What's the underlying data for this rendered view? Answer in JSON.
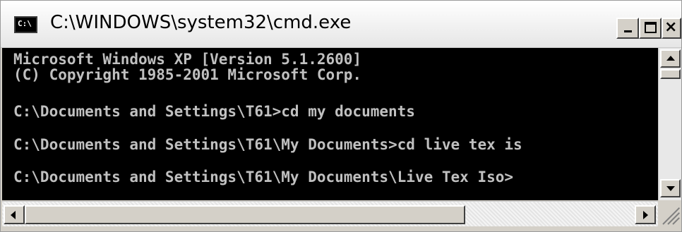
{
  "window": {
    "title": "C:\\WINDOWS\\system32\\cmd.exe",
    "icon_text": "C:\\",
    "minimize_label": "minimize",
    "maximize_label": "maximize",
    "close_label": "×"
  },
  "console": {
    "lines": [
      "Microsoft Windows XP [Version 5.1.2600]",
      "(C) Copyright 1985-2001 Microsoft Corp.",
      "",
      "C:\\Documents and Settings\\T61>cd my documents",
      "",
      "C:\\Documents and Settings\\T61\\My Documents>cd live tex is",
      "",
      "C:\\Documents and Settings\\T61\\My Documents\\Live Tex Iso>"
    ]
  },
  "colors": {
    "console_background": "#000000",
    "console_text": "#c0c0c0",
    "chrome": "#d4d0c8"
  },
  "scrollbars": {
    "vertical": {
      "up_icon": "arrow-up-icon",
      "down_icon": "arrow-down-icon"
    },
    "horizontal": {
      "left_icon": "arrow-left-icon",
      "right_icon": "arrow-right-icon"
    }
  }
}
